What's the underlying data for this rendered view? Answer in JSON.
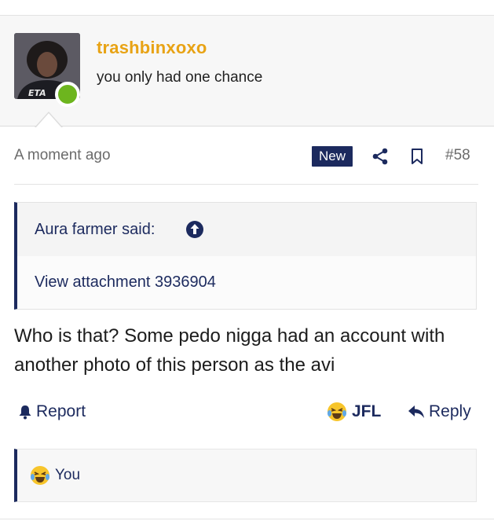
{
  "post": {
    "user": {
      "username": "trashbinxoxo",
      "title": "you only had one chance",
      "avatar_shirt_text": "ETA"
    },
    "meta": {
      "timestamp": "A moment ago",
      "badge": "New",
      "post_number": "#58"
    },
    "quote": {
      "author": "Aura farmer said:",
      "body": "View attachment 3936904"
    },
    "text": "Who is that? Some pedo nigga had an account with another photo of this person as the avi",
    "actions": {
      "report": "Report",
      "reaction": "JFL",
      "reply": "Reply"
    },
    "reactions_summary": "You"
  },
  "colors": {
    "username": "#e8a315",
    "accent": "#1c2a5e",
    "online": "#6db51e"
  },
  "icons": [
    "share-icon",
    "bookmark-icon",
    "arrow-up-circle-icon",
    "bell-icon",
    "laughing-crying-emoji-icon",
    "reply-arrow-icon"
  ]
}
